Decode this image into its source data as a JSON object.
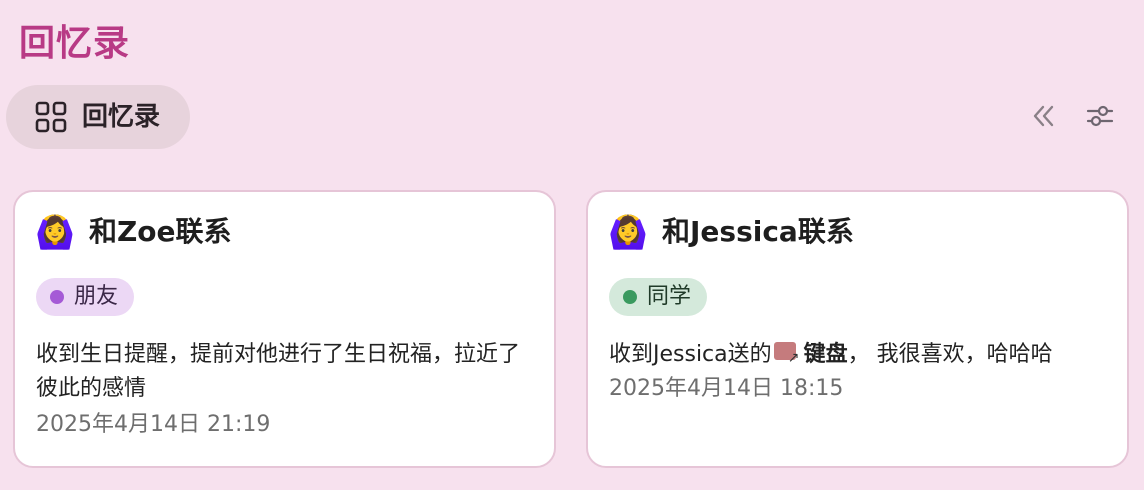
{
  "header": {
    "title": "回忆录"
  },
  "toolbar": {
    "view_label": "回忆录",
    "view_icon": "grid-icon",
    "collapse_icon": "double-chevron-left-icon",
    "filter_icon": "sliders-icon"
  },
  "cards": [
    {
      "emoji": "🙆‍♀️",
      "title": "和Zoe联系",
      "tag": "朋友",
      "tag_color": "#a55ad6",
      "description": "收到生日提醒，提前对他进行了生日祝福，拉近了彼此的感情",
      "date": "2025年4月14日 21:19"
    },
    {
      "emoji": "🙆‍♀️",
      "title": "和Jessica联系",
      "tag": "同学",
      "tag_color": "#3a9a5f",
      "description_prefix": "收到Jessica送的",
      "description_item": "键盘",
      "description_suffix": "， 我很喜欢，哈哈哈",
      "date": "2025年4月14日 18:15"
    }
  ],
  "colors": {
    "background": "#f7e1ee",
    "title": "#b83a85",
    "pill": "#e7d3dc"
  }
}
